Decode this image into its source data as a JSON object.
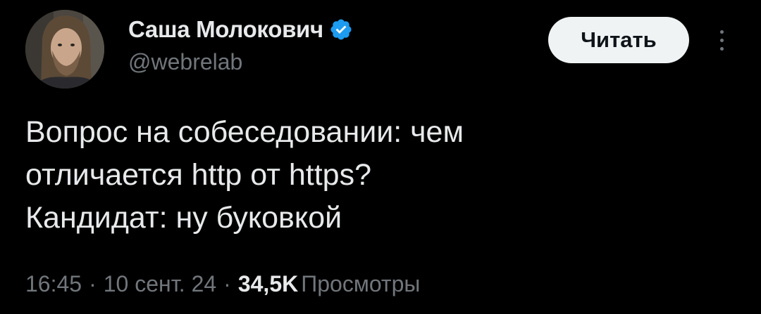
{
  "author": {
    "display_name": "Саша Молокович",
    "handle": "@webrelab",
    "verified": true,
    "avatar_icon": "user-avatar-photo"
  },
  "actions": {
    "follow_label": "Читать",
    "more_icon": "more-vertical-icon"
  },
  "tweet": {
    "lines": [
      "Вопрос на собеседовании: чем",
      "отличается http от https?",
      "Кандидат: ну буковкой"
    ]
  },
  "meta": {
    "time": "16:45",
    "separator": "·",
    "date": "10 сент. 24",
    "views_count": "34,5K",
    "views_label": "Просмотры"
  },
  "colors": {
    "background": "#000000",
    "primary_text": "#e7e9ea",
    "secondary_text": "#71767b",
    "verified_blue": "#1d9bf0",
    "button_bg": "#eff3f4",
    "button_text": "#0f1419"
  }
}
